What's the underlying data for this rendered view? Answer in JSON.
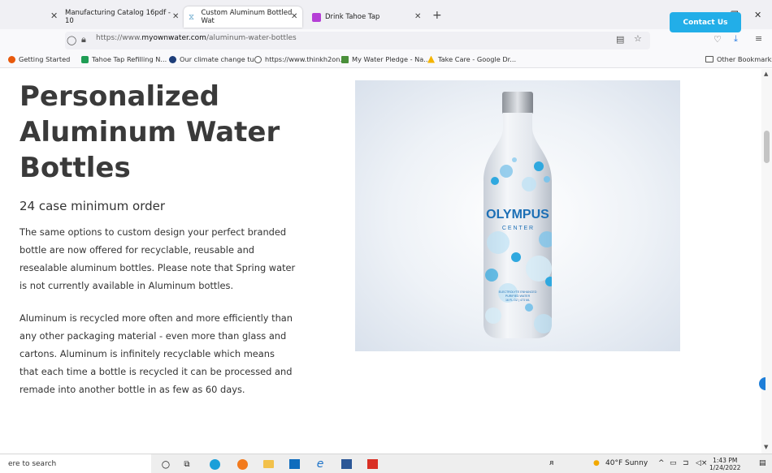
{
  "tabs": [
    {
      "title": "Manufacturing Catalog 16pdf - 10"
    },
    {
      "title": "Custom Aluminum Bottled Wat"
    },
    {
      "title": "Drink Tahoe Tap"
    }
  ],
  "nav": {
    "url_prefix": "https://www.",
    "url_domain": "myownwater.com",
    "url_path": "/aluminum-water-bottles"
  },
  "bookmarks": [
    {
      "label": "Getting Started",
      "color": "#e8590c"
    },
    {
      "label": "Tahoe Tap Refilling N...",
      "color": "#1f9d55"
    },
    {
      "label": "Our climate change tu...",
      "color": "#1f3f7a"
    },
    {
      "label": "https://www.thinkh2on...",
      "color": "#555555"
    },
    {
      "label": "My Water Pledge - Na...",
      "color": "#4a8f3a"
    },
    {
      "label": "Take Care - Google Dr...",
      "color": "#f4b400"
    }
  ],
  "bookmarks_other": "Other Bookmarks",
  "page": {
    "title": "Personalized Aluminum Water Bottles",
    "subtitle": "24 case minimum order",
    "paragraph1": "The same options to custom design your perfect branded bottle are now offered for recyclable, reusable and resealable aluminum bottles. Please note that Spring water is not currently available in Aluminum bottles.",
    "paragraph2": "Aluminum is recycled more often and more efficiently than any other packaging material - even more than glass and cartons. Aluminum is infinitely recyclable which means that each time a bottle is recycled it can be processed and remade into another bottle in as few as 60 days.",
    "contact_button": "Contact Us"
  },
  "bottle": {
    "brand": "OLYMPUS",
    "brand_sub": "C E N T E R",
    "label_line1": "ELECTROLYTE ENHANCED",
    "label_line2": "PURIFIED WATER",
    "label_line3": "16 FL OZ | 473 ML"
  },
  "taskbar": {
    "search_text": "ere to search",
    "weather": "40°F  Sunny",
    "time": "1:43 PM",
    "date": "1/24/2022"
  },
  "colors": {
    "accent": "#22aee8",
    "bottle_blue": "#2fa8df"
  }
}
